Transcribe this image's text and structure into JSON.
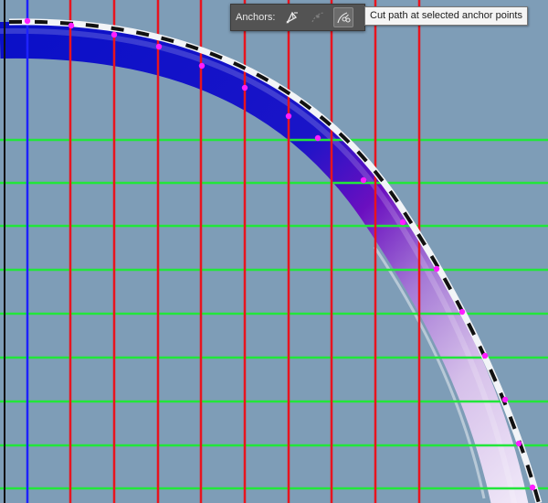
{
  "toolbar": {
    "anchors_label": "Anchors:",
    "buttons": [
      {
        "icon": "convert-anchor-pen-icon",
        "enabled": true,
        "active": false
      },
      {
        "icon": "remove-anchor-icon",
        "enabled": false,
        "active": false
      },
      {
        "icon": "cut-path-scissors-icon",
        "enabled": true,
        "active": true
      }
    ]
  },
  "tooltip": {
    "text": "Cut path at selected anchor points"
  },
  "colors": {
    "canvas_background": "#7e9db7",
    "guide_vertical": "#e8141e",
    "guide_horizontal": "#22e63a",
    "guide_blue": "#1e22ff",
    "stroke_blue": "#0a10c8",
    "stroke_purple": "#6a0fc0",
    "stroke_lavender": "#cfb2e6",
    "anchor_magenta": "#ff1dff",
    "dash_black": "#111111"
  }
}
